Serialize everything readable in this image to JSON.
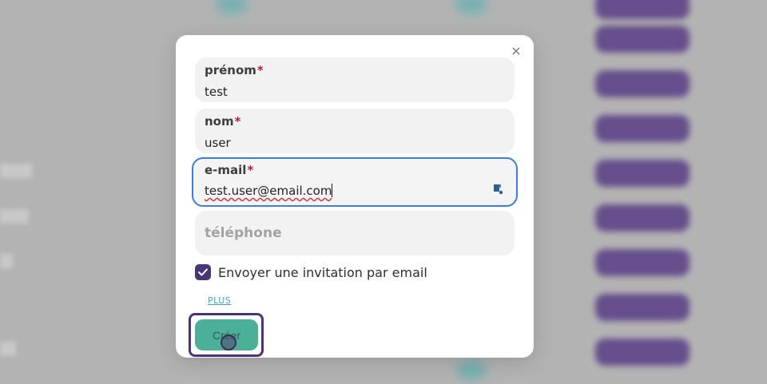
{
  "modal": {
    "close_label": "×",
    "fields": [
      {
        "label": "prénom",
        "required_mark": "*",
        "value": "test"
      },
      {
        "label": "nom",
        "required_mark": "*",
        "value": "user"
      },
      {
        "label": "e-mail",
        "required_mark": "*",
        "value": "test.user@email.com"
      },
      {
        "label": "téléphone",
        "value": ""
      }
    ],
    "invite_checkbox": {
      "label": "Envoyer une invitation par email",
      "checked": true
    },
    "more_link": "PLUS",
    "create_button": "Créer"
  },
  "colors": {
    "accent_purple": "#4a3479",
    "create_green": "#4caf98",
    "focus_blue": "#3b7ddd",
    "required_red": "#b0233a",
    "link_cyan": "#3aa9c6"
  },
  "icons": {
    "close": "close-icon",
    "checkbox": "check-icon",
    "password_manager": "password-manager-icon"
  }
}
